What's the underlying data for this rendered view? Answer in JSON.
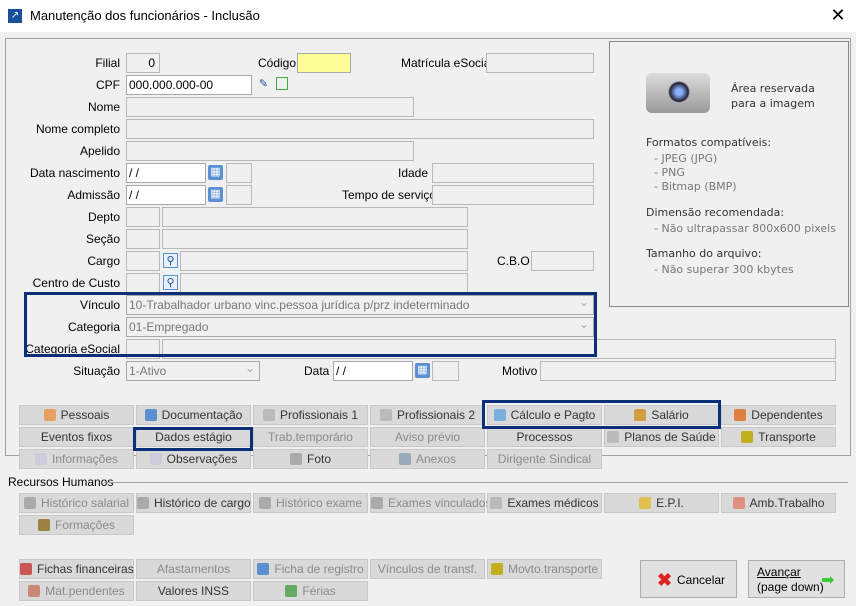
{
  "window": {
    "title": "Manutenção dos funcionários - Inclusão",
    "close": "✕"
  },
  "form": {
    "filial_label": "Filial",
    "filial": "0",
    "codigo_label": "Código",
    "codigo": "",
    "matricula_label": "Matrícula eSocial",
    "cpf_label": "CPF",
    "cpf": "000.000.000-00",
    "nome_label": "Nome",
    "nome_completo_label": "Nome completo",
    "apelido_label": "Apelido",
    "data_nasc_label": "Data nascimento",
    "data_nasc": "/ /",
    "idade_label": "Idade",
    "admissao_label": "Admissão",
    "admissao": "/ /",
    "tempo_label": "Tempo de serviço",
    "depto_label": "Depto",
    "secao_label": "Seção",
    "cargo_label": "Cargo",
    "cbo_label": "C.B.O",
    "centro_label": "Centro de Custo",
    "vinculo_label": "Vínculo",
    "vinculo": "10-Trabalhador urbano vinc.pessoa jurídica p/prz indeterminado",
    "categoria_label": "Categoria",
    "categoria": "01-Empregado",
    "cat_esocial_label": "Categoria eSocial",
    "situacao_label": "Situação",
    "situacao": "1-Ativo",
    "data_label": "Data",
    "data": "/ /",
    "motivo_label": "Motivo"
  },
  "photo": {
    "reserved": "Área reservada",
    "reserved2": "para a imagem",
    "formats_title": "Formatos compatíveis:",
    "formats": [
      "- JPEG (JPG)",
      "- PNG",
      "- Bitmap (BMP)"
    ],
    "dim_title": "Dimensão recomendada:",
    "dim": "- Não ultrapassar 800x600 pixels",
    "size_title": "Tamanho do arquivo:",
    "size": "- Não superar 300 kbytes"
  },
  "tabs": [
    [
      {
        "label": "Pessoais",
        "icon": "#e8a060"
      },
      {
        "label": "Documentação",
        "icon": "#5a8fd0"
      },
      {
        "label": "Profissionais 1",
        "icon": "#bbb"
      },
      {
        "label": "Profissionais 2",
        "icon": "#bbb"
      },
      {
        "label": "Cálculo e Pagto",
        "icon": "#7ab0e0"
      },
      {
        "label": "Salário",
        "icon": "#d0a040"
      },
      {
        "label": "Dependentes",
        "icon": "#e08040"
      }
    ],
    [
      {
        "label": "Eventos fixos"
      },
      {
        "label": "Dados estágio"
      },
      {
        "label": "Trab.temporário",
        "dis": true
      },
      {
        "label": "Aviso prévio",
        "dis": true
      },
      {
        "label": "Processos"
      },
      {
        "label": "Planos de Saúde",
        "icon": "#bbb"
      },
      {
        "label": "Transporte",
        "icon": "#c0b020"
      }
    ],
    [
      {
        "label": "Informações",
        "icon": "#ccd",
        "dis": true
      },
      {
        "label": "Observações",
        "icon": "#ccd"
      },
      {
        "label": "Foto",
        "icon": "#aaa"
      },
      {
        "label": "Anexos",
        "icon": "#9ab",
        "dis": true
      },
      {
        "label": "Dirigente Sindical",
        "dis": true
      }
    ]
  ],
  "rh_title": "Recursos Humanos",
  "rh": [
    [
      {
        "label": "Histórico salarial",
        "icon": "#aaa",
        "dis": true
      },
      {
        "label": "Histórico de cargo",
        "icon": "#aaa"
      },
      {
        "label": "Histórico exame",
        "icon": "#aaa",
        "dis": true
      },
      {
        "label": "Exames vinculados",
        "icon": "#aaa",
        "dis": true
      },
      {
        "label": "Exames médicos",
        "icon": "#bbb"
      },
      {
        "label": "E.P.I.",
        "icon": "#e0c050"
      },
      {
        "label": "Amb.Trabalho",
        "icon": "#e09080"
      }
    ],
    [
      {
        "label": "Formações",
        "icon": "#a08040",
        "dis": true
      }
    ]
  ],
  "bottom": [
    [
      {
        "label": "Fichas financeiras",
        "icon": "#c55"
      },
      {
        "label": "Afastamentos",
        "dis": true
      },
      {
        "label": "Ficha de registro",
        "icon": "#5a8fd0",
        "dis": true
      },
      {
        "label": "Vínculos de transf.",
        "dis": true
      },
      {
        "label": "Movto.transporte",
        "icon": "#c0b020",
        "dis": true
      }
    ],
    [
      {
        "label": "Mat.pendentes",
        "icon": "#c87",
        "dis": true
      },
      {
        "label": "Valores INSS"
      },
      {
        "label": "Férias",
        "icon": "#6a6",
        "dis": true
      }
    ]
  ],
  "actions": {
    "cancel": "Cancelar",
    "next": "Avançar",
    "next2": "(page down)"
  },
  "colors": {
    "highlight": "#0c2f7a",
    "codigo_bg": "#ffff99"
  }
}
